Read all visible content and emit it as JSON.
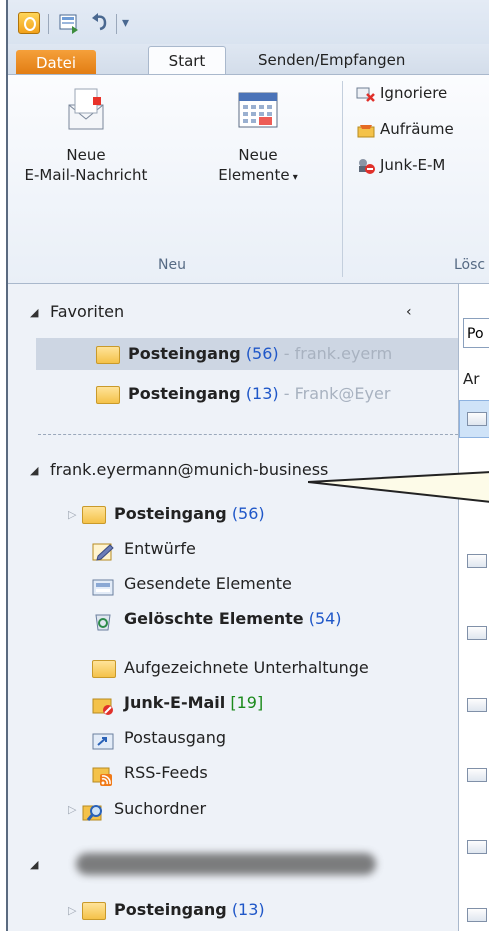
{
  "qat": {
    "icons": [
      "outlook-app-icon",
      "send-receive-icon",
      "undo-icon",
      "customize-icon"
    ]
  },
  "tabs": [
    {
      "label": "Datei"
    },
    {
      "label": "Start"
    },
    {
      "label": "Senden/Empfangen"
    }
  ],
  "ribbon": {
    "new_mail_line1": "Neue",
    "new_mail_line2": "E-Mail-Nachricht",
    "new_items_line1": "Neue",
    "new_items_line2": "Elemente",
    "group_new": "Neu",
    "ignore": "Ignoriere",
    "cleanup": "Aufräume",
    "junk": "Junk-E-M",
    "group_delete": "Lösc"
  },
  "nav": {
    "favorites": "Favoriten",
    "fav_inbox1": {
      "name": "Posteingang",
      "count": "(56)",
      "account": " - frank.eyerm"
    },
    "fav_inbox2": {
      "name": "Posteingang",
      "count": "(13)",
      "account": " - Frank@Eyer"
    },
    "account": "frank.eyermann@munich-business",
    "folders": {
      "inbox": {
        "name": "Posteingang",
        "count": "(56)"
      },
      "drafts": "Entwürfe",
      "sent": "Gesendete Elemente",
      "deleted": {
        "name": "Gelöschte Elemente",
        "count": "(54)"
      },
      "recorded": "Aufgezeichnete Unterhaltunge",
      "junk": {
        "name": "Junk-E-Mail",
        "count": "[19]"
      },
      "outbox": "Postausgang",
      "rss": "RSS-Feeds",
      "search": "Suchordner"
    },
    "account2_inbox": {
      "name": "Posteingang",
      "count": "(13)"
    }
  },
  "list": {
    "search_prefix": "Po",
    "col_header": "Ar"
  }
}
